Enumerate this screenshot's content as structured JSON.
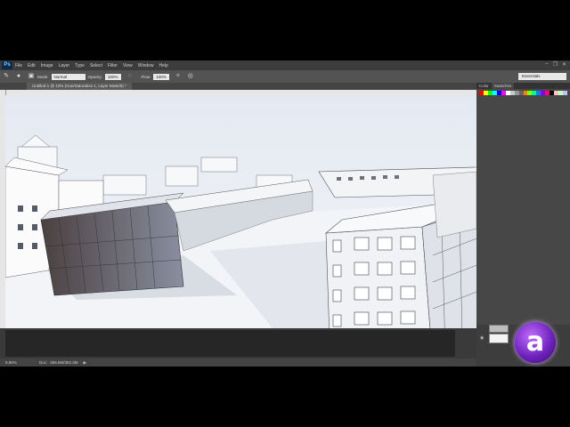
{
  "app": {
    "logo_text": "Ps"
  },
  "menu": [
    "File",
    "Edit",
    "Image",
    "Layer",
    "Type",
    "Select",
    "Filter",
    "View",
    "Window",
    "Help"
  ],
  "window_controls": [
    "–",
    "❐",
    "✕"
  ],
  "options_bar": {
    "mode_label": "Mode:",
    "mode_value": "Normal",
    "opacity_label": "Opacity:",
    "opacity_value": "100%",
    "flow_label": "Flow:",
    "flow_value": "100%",
    "workspace": "Essentials"
  },
  "document_tab": {
    "title": "Untitled-1 @ 10% (Hue/Saturation 1, Layer Mask/8) *"
  },
  "right_panel": {
    "tabs": [
      "Color",
      "Swatches"
    ],
    "swatch_colors": [
      "#ff0000",
      "#ffff00",
      "#00ff00",
      "#00ffff",
      "#0000ff",
      "#ff00ff",
      "#ffffff",
      "#c8c8c8",
      "#969696",
      "#646464",
      "#ff7f00",
      "#7fff00",
      "#00ff7f",
      "#007fff",
      "#7f00ff",
      "#ff007f",
      "#000000",
      "#ffc0c0",
      "#c0ffc0",
      "#c0c0ff"
    ]
  },
  "status": {
    "zoom": "9.96%",
    "doc_label": "Doc:",
    "doc_value": "356.6M/362.3M"
  },
  "colors": {
    "brand_logo": "#7b2fd1"
  }
}
